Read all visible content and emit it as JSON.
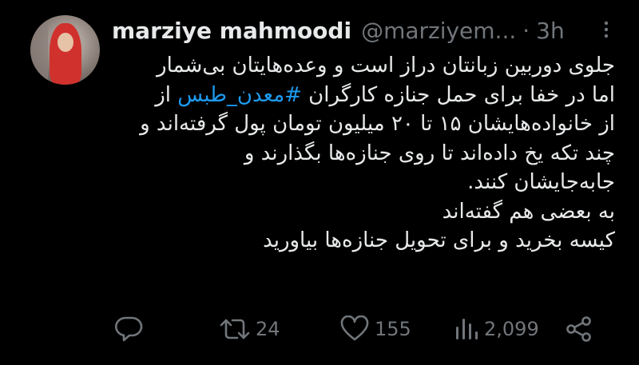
{
  "tweet": {
    "author_name": "marziye mahmoodi",
    "author_handle": "@marziyem...",
    "separator": "·",
    "time": "3h",
    "lines": [
      "جلوی دوربین زبانتان دراز است و وعده‌هایتان بی‌شمار",
      "از خانواده‌هایشان ۱۵ تا ۲۰ میلیون تومان پول گرفته‌اند و",
      "چند تکه یخ داده‌اند تا روی جنازه‌ها بگذارند و",
      "جابه‌جایشان کنند.",
      "به بعضی هم گفته‌اند",
      "کیسه بخرید و برای تحویل جنازه‌ها بیاورید"
    ],
    "line2_before": "اما در خفا برای حمل جنازه کارگران ",
    "hashtag": "#معدن_طبس",
    "line2_after": " از"
  },
  "actions": {
    "reply_count": "",
    "retweet_count": "24",
    "like_count": "155",
    "view_count": "2,099"
  },
  "icons": {
    "more": "more-icon",
    "reply": "reply-icon",
    "retweet": "retweet-icon",
    "like": "heart-icon",
    "views": "analytics-icon",
    "share": "share-icon"
  },
  "colors": {
    "background": "#000000",
    "text": "#e7e9ea",
    "muted": "#71767b",
    "hashtag": "#1d9bf0"
  }
}
